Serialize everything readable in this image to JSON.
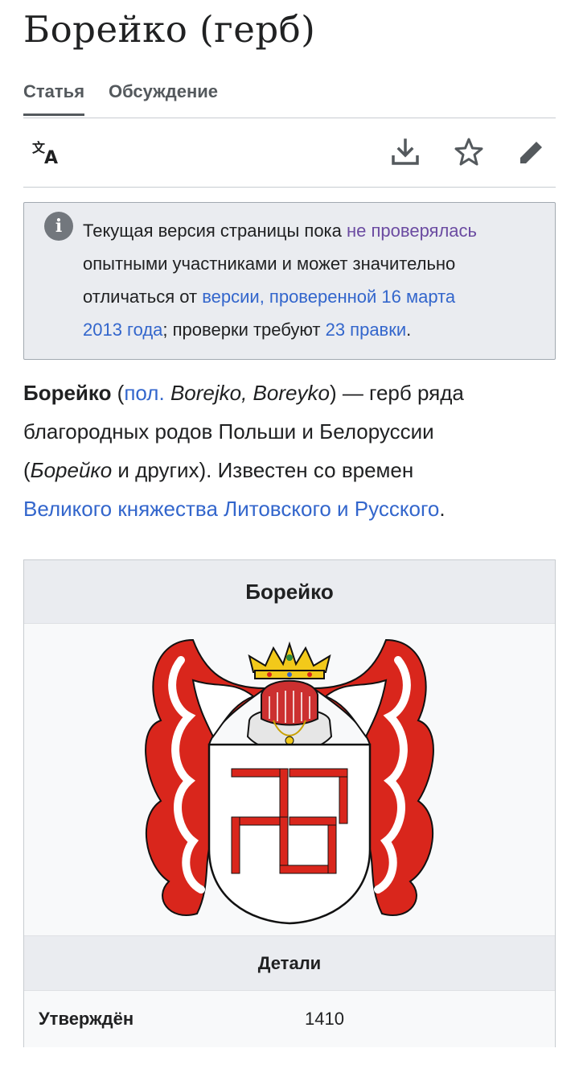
{
  "page": {
    "title": "Борейко (герб)"
  },
  "tabs": [
    {
      "label": "Статья",
      "active": true
    },
    {
      "label": "Обсуждение",
      "active": false
    }
  ],
  "toolbar": {
    "icons": [
      "language-icon",
      "download-icon",
      "star-icon",
      "edit-icon"
    ]
  },
  "notice": {
    "icon": "info-icon",
    "line1_prefix": "Текущая версия страницы пока ",
    "line1_link": "не проверялась",
    "line2": "опытными участниками и может значительно",
    "line3_prefix": "отличаться от ",
    "line3_link": "версии, проверенной 16 марта",
    "line4_link": "2013 года",
    "line4_mid": "; проверки требуют ",
    "line4_link2": "23 правки",
    "line4_suffix": "."
  },
  "lead": {
    "bold": "Борейко",
    "paren_open": " (",
    "lang_link": "пол.",
    "lang_names": " Borejko, Boreyko",
    "after_paren": ") — герб ряда",
    "line2": "благородных родов Польши и Белоруссии",
    "line3_open": "(",
    "line3_italic": "Борейко",
    "line3_rest": " и других). Известен со времен",
    "link": "Великого княжества Литовского и Русского",
    "end": "."
  },
  "infobox": {
    "title": "Борейко",
    "image": "coat-of-arms-image",
    "subheader": "Детали",
    "rows": [
      {
        "key": "Утверждён",
        "value": "1410"
      }
    ]
  },
  "colors": {
    "link": "#3366cc",
    "visited_link": "#6b4ba1",
    "notice_bg": "#eaecf0",
    "heraldic_red": "#d9261c",
    "gold": "#f2c91a"
  }
}
